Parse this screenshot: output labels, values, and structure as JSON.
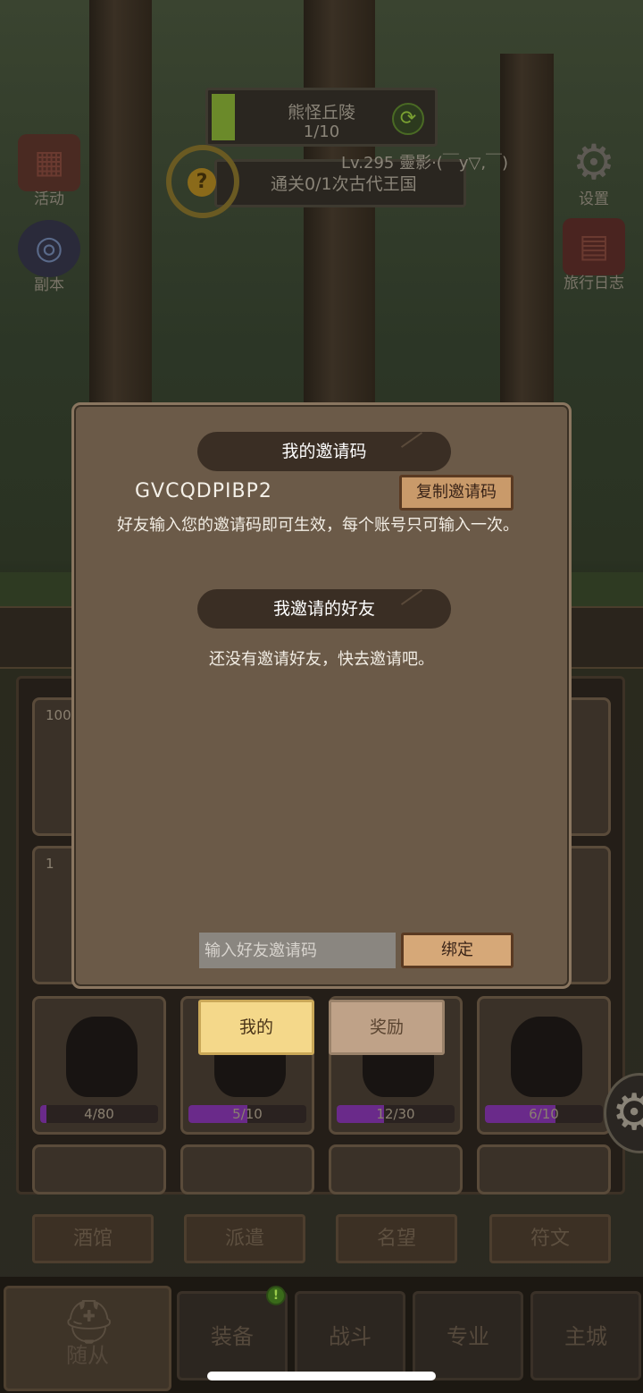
{
  "hud": {
    "stage_title": "熊怪丘陵",
    "stage_progress": "1/10",
    "player_line": "Lv.295 靈影·(￣y▽,￣)",
    "quest_text": "通关0/1次古代王国"
  },
  "side_left": [
    {
      "label": "活动",
      "icon": "calendar-icon"
    },
    {
      "label": "副本",
      "icon": "portal-icon"
    }
  ],
  "side_right": [
    {
      "label": "设置",
      "icon": "gear-icon"
    },
    {
      "label": "旅行日志",
      "icon": "journal-icon"
    }
  ],
  "inventory": {
    "slot_corner_1": "100",
    "slot_corner_2": "1",
    "progress": [
      {
        "text": "4/80",
        "fraction": 0.05
      },
      {
        "text": "5/10",
        "fraction": 0.5
      },
      {
        "text": "12/30",
        "fraction": 0.4
      },
      {
        "text": "6/10",
        "fraction": 0.6
      }
    ]
  },
  "sub_buttons": [
    "酒馆",
    "派遣",
    "名望",
    "符文"
  ],
  "bottom_nav": [
    "随从",
    "装备",
    "战斗",
    "专业",
    "主城"
  ],
  "modal": {
    "my_code_header": "我的邀请码",
    "invite_code": "GVCQDPIBP2",
    "copy_button": "复制邀请码",
    "hint": "好友输入您的邀请码即可生效，每个账号只可输入一次。",
    "friends_header": "我邀请的好友",
    "empty_text": "还没有邀请好友，快去邀请吧。",
    "input_placeholder": "输入好友邀请码",
    "bind_button": "绑定"
  },
  "modal_tabs": {
    "mine": "我的",
    "reward": "奖励"
  },
  "colors": {
    "modal_bg": "#6b5a48",
    "active_tab": "#f4d88a",
    "progress_fill": "#6a2a8a"
  }
}
